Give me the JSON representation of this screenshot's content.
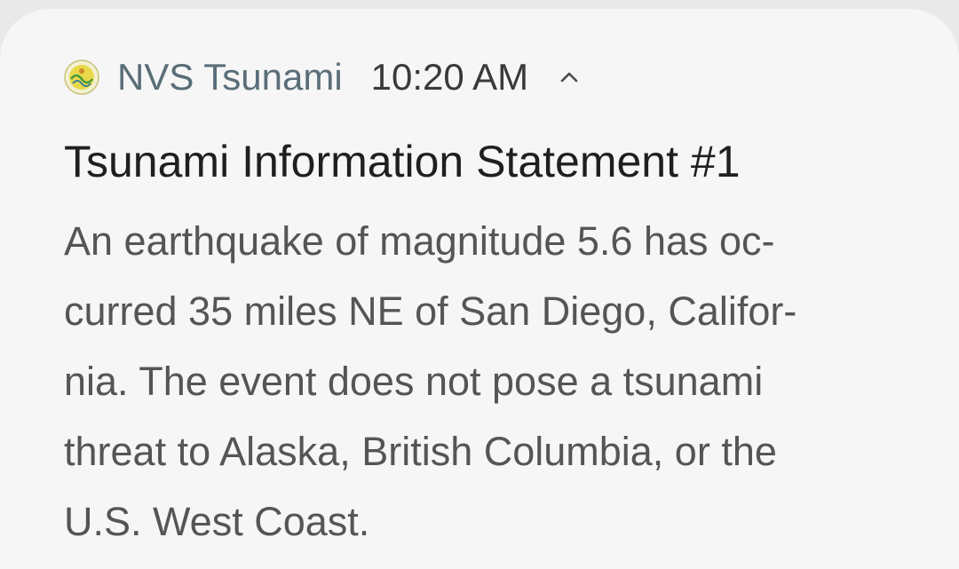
{
  "notification": {
    "app_icon": "nvs-seal-icon",
    "app_name": "NVS Tsunami",
    "time": "10:20 AM",
    "expand_icon": "chevron-up-icon",
    "title": "Tsunami Information Statement #1",
    "body_lines": [
      "An earthquake of magnitude 5.6 has oc-",
      "curred 35 miles NE of San Diego, Califor-",
      "nia. The event does not pose a tsunami",
      "threat to Alaska, British Columbia, or the",
      "U.S. West Coast."
    ]
  },
  "colors": {
    "card_background": "#f6f6f6",
    "page_background": "#e9e9e9",
    "app_name": "#5a6e78",
    "title": "#1f1f1f",
    "body": "#555555"
  }
}
